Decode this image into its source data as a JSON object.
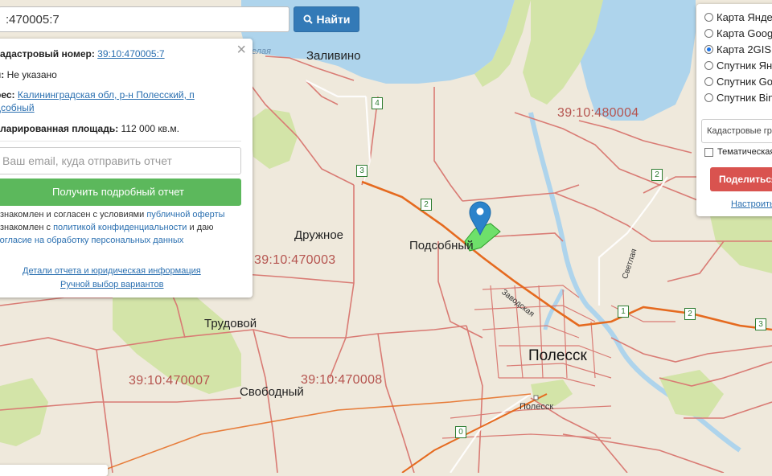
{
  "search": {
    "value": ":470005:7",
    "button_label": "Найти"
  },
  "info_panel": {
    "cadastral_label": "кадастровый номер:",
    "cadastral_value": "39:10:470005:7",
    "type_label": "п:",
    "type_value": "Не указано",
    "address_label": "рес:",
    "address_line1": "Калининградская обл, р-н Полесский, п",
    "address_line2": "дсобный",
    "area_label": "кларированная площадь:",
    "area_value": "112 000 кв.м.",
    "email_placeholder": "Ваш email, куда отправить отчет",
    "report_button": "Получить подробный отчет",
    "agree1_text": "ознакомлен и согласен с условиями",
    "agree1_link": "публичной оферты",
    "agree2_text": "ознакомлен с",
    "agree2_link": "политикой конфиденциальности",
    "agree2_tail": "и даю",
    "agree3_link": "согласие на обработку персональных данных",
    "details_link": "Детали отчета и юридическая информация",
    "manual_link": "Ручной выбор вариантов"
  },
  "layers_panel": {
    "options": [
      {
        "label": "Карта Яндекс",
        "selected": false
      },
      {
        "label": "Карта Google",
        "selected": false
      },
      {
        "label": "Карта 2GIS",
        "selected": true
      },
      {
        "label": "Спутник Яндекс",
        "selected": false
      },
      {
        "label": "Спутник Google",
        "selected": false
      },
      {
        "label": "Спутник Bing",
        "selected": false
      }
    ],
    "select_value": "Кадастровые границы",
    "thematic_label": "Тематическая карта",
    "share_button": "Поделиться",
    "configure_link": "Настроить"
  },
  "map": {
    "settlements": [
      "Заливино",
      "Дружное",
      "Подсобный",
      "Трудовой",
      "Свободный",
      "Полесск",
      "Полесск"
    ],
    "cadastral_quarters": [
      "39:10:480004",
      "39:10:470003",
      "39:10:470007",
      "39:10:470008"
    ],
    "water_label": "елая",
    "street_labels": [
      "Заводская",
      "Светлая"
    ],
    "road_numbers": [
      "4",
      "3",
      "2",
      "2",
      "1",
      "2",
      "3",
      "0"
    ],
    "colors": {
      "land": "#efe9dc",
      "water": "#aed4ec",
      "forest": "#d3e4a8",
      "cadastral_border": "#d97b74",
      "main_road": "#e56a1f",
      "parcel_highlight": "#6ee06a",
      "marker": "#2b83cb"
    }
  }
}
